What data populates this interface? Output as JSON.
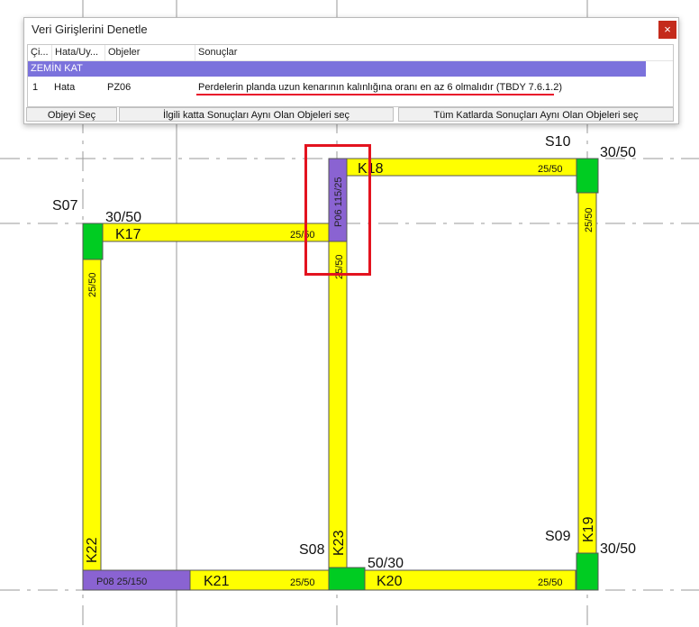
{
  "dialog": {
    "title": "Veri Girişlerini Denetle",
    "close_label": "×",
    "columns": [
      "Çi...",
      "Hata/Uy...",
      "Objeler",
      "Sonuçlar"
    ],
    "group": "ZEMİN KAT",
    "rows": [
      {
        "no": "1",
        "type": "Hata",
        "object": "PZ06",
        "result": "Perdelerin planda uzun kenarının kalınlığına oranı en az 6 olmalıdır (TBDY 7.6.1.2)"
      }
    ],
    "buttons": {
      "select_object": "Objeyi Seç",
      "select_same_floor": "İlgili katta Sonuçları Aynı Olan Objeleri seç",
      "select_all_floors": "Tüm Katlarda Sonuçları Aynı Olan Objeleri seç"
    }
  },
  "plan": {
    "columns": [
      {
        "id": "S07",
        "size": "30/50"
      },
      {
        "id": "S10",
        "size": "30/50"
      },
      {
        "id": "S08",
        "size": "50/30"
      },
      {
        "id": "S09",
        "size": "30/50"
      }
    ],
    "beams": [
      {
        "id": "K17",
        "size": "25/50"
      },
      {
        "id": "K18",
        "size": "25/50"
      },
      {
        "id": "K21",
        "size": "25/50"
      },
      {
        "id": "K20",
        "size": "25/50"
      },
      {
        "id": "K22",
        "size": "25/50"
      },
      {
        "id": "K23",
        "size": "25/50"
      },
      {
        "id": "K19",
        "size": "25/50"
      }
    ],
    "walls": [
      {
        "id": "P06",
        "size": "115/25"
      },
      {
        "id": "P08",
        "size": "25/150"
      }
    ]
  },
  "colors": {
    "beam": "#ffff00",
    "column": "#00cc22",
    "wall": "#8a63d2",
    "group_header": "#7b72dc",
    "highlight": "#e3131f",
    "underline": "#e8102a"
  }
}
